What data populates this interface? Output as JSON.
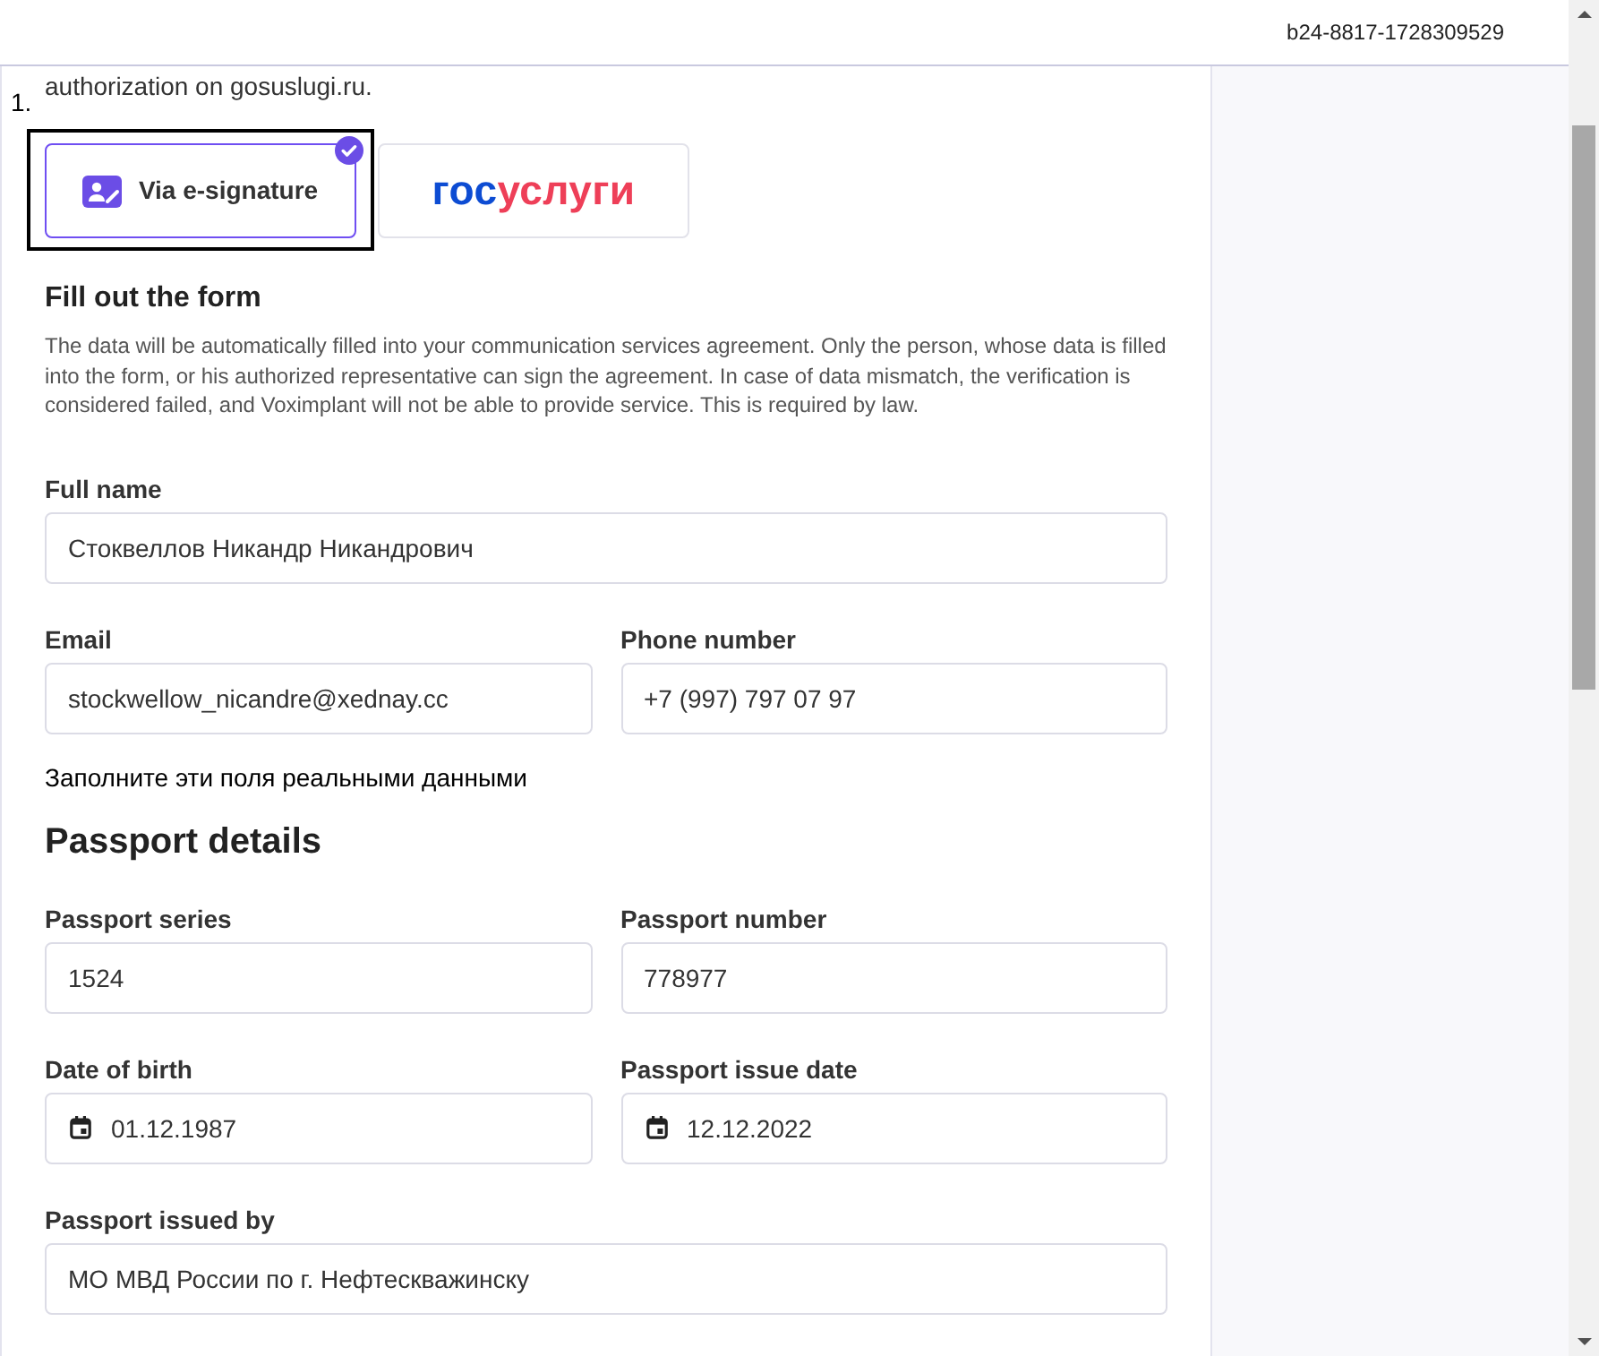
{
  "header": {
    "request_id": "b24-8817-1728309529"
  },
  "step": {
    "number": "1.",
    "text": "authorization on gosuslugi.ru."
  },
  "methods": [
    {
      "kind": "esignature",
      "label": "Via e-signature",
      "selected": true,
      "focused": true
    },
    {
      "kind": "logo",
      "logo_prefix": "гос",
      "logo_suffix": "услуги",
      "selected": false,
      "focused": false
    }
  ],
  "form": {
    "title": "Fill out the form",
    "description": "The data will be automatically filled into your communication services agreement. Only the person, whose data is filled into the form, or his authorized representative can sign the agreement. In case of data mismatch, the verification is considered failed, and Voximplant will not be able to provide service. This is required by law.",
    "rows": [
      [
        {
          "kind": "text",
          "label": "Full name",
          "value": "Стоквеллов Никандр Никандрович"
        }
      ],
      [
        {
          "kind": "text",
          "label": "Email",
          "value": "stockwellow_nicandre@xednay.cc"
        },
        {
          "kind": "text",
          "label": "Phone number",
          "value": "+7 (997) 797 07 97"
        }
      ]
    ]
  },
  "note": "Заполните эти поля реальными данными",
  "passport": {
    "title": "Passport details",
    "rows": [
      [
        {
          "kind": "text",
          "label": "Passport series",
          "value": "1524"
        },
        {
          "kind": "text",
          "label": "Passport number",
          "value": "778977"
        }
      ],
      [
        {
          "kind": "date",
          "label": "Date of birth",
          "value": "01.12.1987"
        },
        {
          "kind": "date",
          "label": "Passport issue date",
          "value": "12.12.2022"
        }
      ],
      [
        {
          "kind": "text",
          "label": "Passport issued by",
          "value": "МО МВД России по г. Нефтескважинску"
        }
      ]
    ]
  }
}
